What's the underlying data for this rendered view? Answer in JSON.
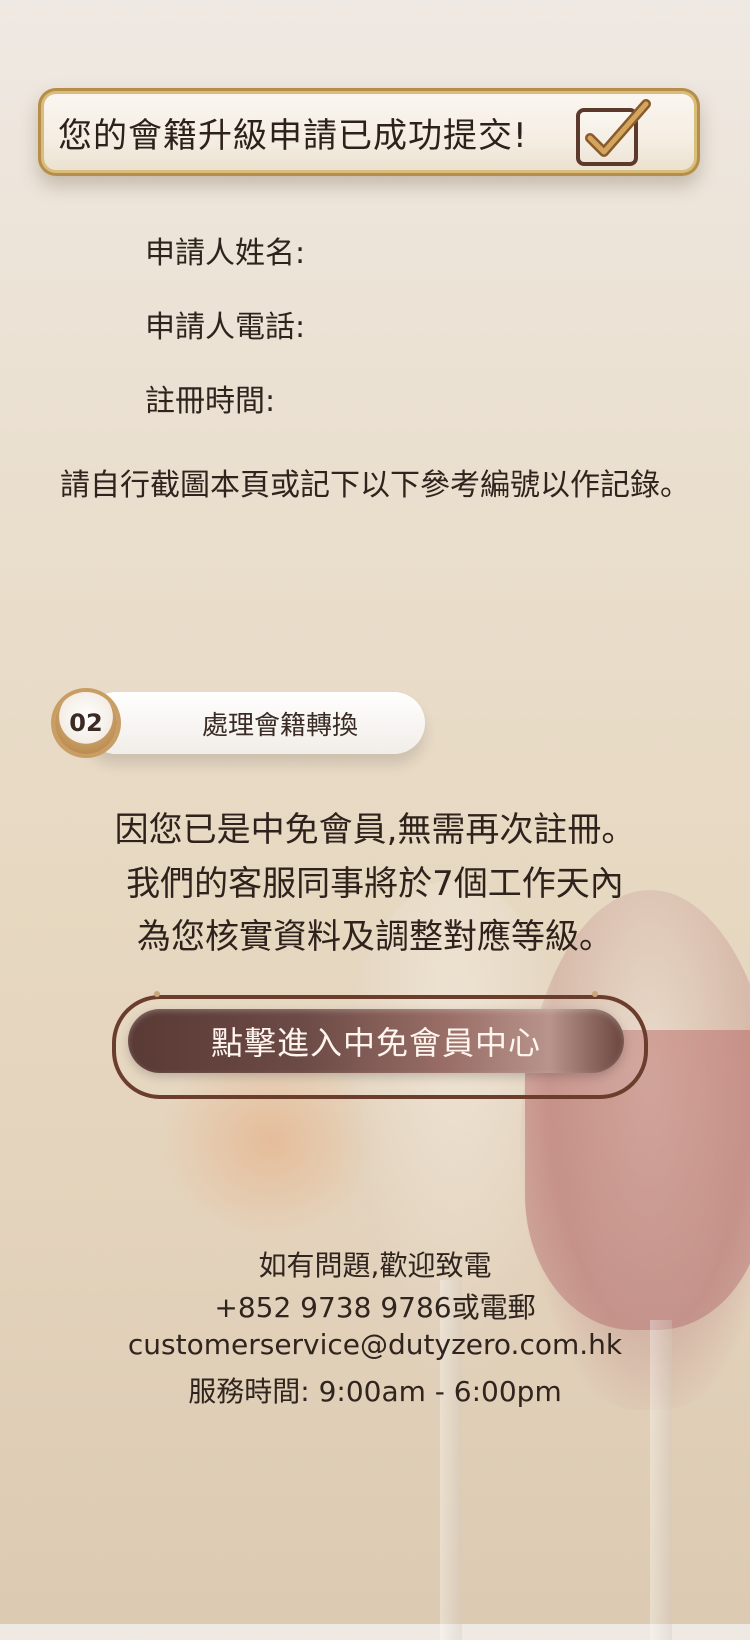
{
  "banner": {
    "title": "您的會籍升級申請已成功提交!",
    "icon": "checkbox-checked-icon"
  },
  "applicant": {
    "name_label": "申請人姓名:",
    "phone_label": "申請人電話:",
    "time_label": "註冊時間:"
  },
  "note": "請自行截圖本頁或記下以下參考編號以作記錄。",
  "step": {
    "number": "02",
    "label": "處理會籍轉換"
  },
  "message": {
    "line1": "因您已是中免會員,無需再次註冊。",
    "line2": "我們的客服同事將於7個工作天內",
    "line3": "為您核實資料及調整對應等級。"
  },
  "cta": {
    "label": "點擊進入中免會員中心"
  },
  "contact": {
    "line1": "如有問題,歡迎致電",
    "line2": "+852 9738 9786或電郵",
    "line3": "customerservice@dutyzero.com.hk",
    "line4": "服務時間: 9:00am - 6:00pm"
  },
  "colors": {
    "accent_gold": "#b68e4a",
    "button_brown": "#5a3a35",
    "text_dark": "#2f231d"
  }
}
